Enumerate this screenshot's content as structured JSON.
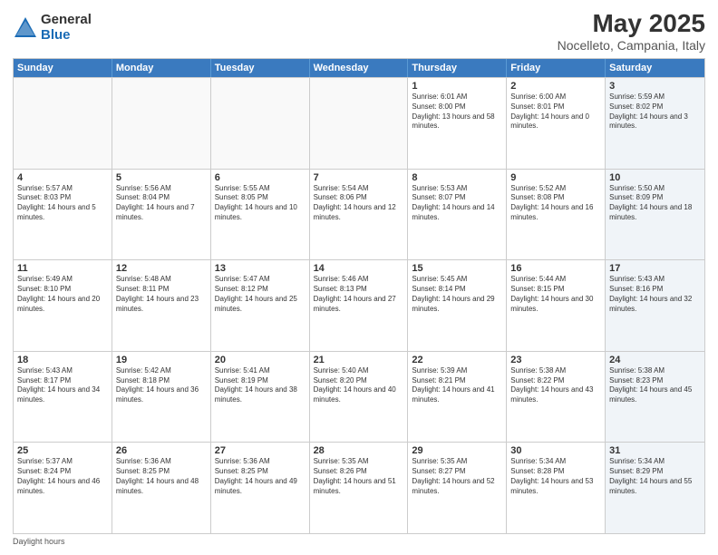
{
  "logo": {
    "general": "General",
    "blue": "Blue"
  },
  "title": "May 2025",
  "subtitle": "Nocelleto, Campania, Italy",
  "headers": [
    "Sunday",
    "Monday",
    "Tuesday",
    "Wednesday",
    "Thursday",
    "Friday",
    "Saturday"
  ],
  "rows": [
    [
      {
        "day": "",
        "empty": true
      },
      {
        "day": "",
        "empty": true
      },
      {
        "day": "",
        "empty": true
      },
      {
        "day": "",
        "empty": true
      },
      {
        "day": "1",
        "sunrise": "Sunrise: 6:01 AM",
        "sunset": "Sunset: 8:00 PM",
        "daylight": "Daylight: 13 hours and 58 minutes."
      },
      {
        "day": "2",
        "sunrise": "Sunrise: 6:00 AM",
        "sunset": "Sunset: 8:01 PM",
        "daylight": "Daylight: 14 hours and 0 minutes."
      },
      {
        "day": "3",
        "sunrise": "Sunrise: 5:59 AM",
        "sunset": "Sunset: 8:02 PM",
        "daylight": "Daylight: 14 hours and 3 minutes.",
        "shaded": true
      }
    ],
    [
      {
        "day": "4",
        "sunrise": "Sunrise: 5:57 AM",
        "sunset": "Sunset: 8:03 PM",
        "daylight": "Daylight: 14 hours and 5 minutes."
      },
      {
        "day": "5",
        "sunrise": "Sunrise: 5:56 AM",
        "sunset": "Sunset: 8:04 PM",
        "daylight": "Daylight: 14 hours and 7 minutes."
      },
      {
        "day": "6",
        "sunrise": "Sunrise: 5:55 AM",
        "sunset": "Sunset: 8:05 PM",
        "daylight": "Daylight: 14 hours and 10 minutes."
      },
      {
        "day": "7",
        "sunrise": "Sunrise: 5:54 AM",
        "sunset": "Sunset: 8:06 PM",
        "daylight": "Daylight: 14 hours and 12 minutes."
      },
      {
        "day": "8",
        "sunrise": "Sunrise: 5:53 AM",
        "sunset": "Sunset: 8:07 PM",
        "daylight": "Daylight: 14 hours and 14 minutes."
      },
      {
        "day": "9",
        "sunrise": "Sunrise: 5:52 AM",
        "sunset": "Sunset: 8:08 PM",
        "daylight": "Daylight: 14 hours and 16 minutes."
      },
      {
        "day": "10",
        "sunrise": "Sunrise: 5:50 AM",
        "sunset": "Sunset: 8:09 PM",
        "daylight": "Daylight: 14 hours and 18 minutes.",
        "shaded": true
      }
    ],
    [
      {
        "day": "11",
        "sunrise": "Sunrise: 5:49 AM",
        "sunset": "Sunset: 8:10 PM",
        "daylight": "Daylight: 14 hours and 20 minutes."
      },
      {
        "day": "12",
        "sunrise": "Sunrise: 5:48 AM",
        "sunset": "Sunset: 8:11 PM",
        "daylight": "Daylight: 14 hours and 23 minutes."
      },
      {
        "day": "13",
        "sunrise": "Sunrise: 5:47 AM",
        "sunset": "Sunset: 8:12 PM",
        "daylight": "Daylight: 14 hours and 25 minutes."
      },
      {
        "day": "14",
        "sunrise": "Sunrise: 5:46 AM",
        "sunset": "Sunset: 8:13 PM",
        "daylight": "Daylight: 14 hours and 27 minutes."
      },
      {
        "day": "15",
        "sunrise": "Sunrise: 5:45 AM",
        "sunset": "Sunset: 8:14 PM",
        "daylight": "Daylight: 14 hours and 29 minutes."
      },
      {
        "day": "16",
        "sunrise": "Sunrise: 5:44 AM",
        "sunset": "Sunset: 8:15 PM",
        "daylight": "Daylight: 14 hours and 30 minutes."
      },
      {
        "day": "17",
        "sunrise": "Sunrise: 5:43 AM",
        "sunset": "Sunset: 8:16 PM",
        "daylight": "Daylight: 14 hours and 32 minutes.",
        "shaded": true
      }
    ],
    [
      {
        "day": "18",
        "sunrise": "Sunrise: 5:43 AM",
        "sunset": "Sunset: 8:17 PM",
        "daylight": "Daylight: 14 hours and 34 minutes."
      },
      {
        "day": "19",
        "sunrise": "Sunrise: 5:42 AM",
        "sunset": "Sunset: 8:18 PM",
        "daylight": "Daylight: 14 hours and 36 minutes."
      },
      {
        "day": "20",
        "sunrise": "Sunrise: 5:41 AM",
        "sunset": "Sunset: 8:19 PM",
        "daylight": "Daylight: 14 hours and 38 minutes."
      },
      {
        "day": "21",
        "sunrise": "Sunrise: 5:40 AM",
        "sunset": "Sunset: 8:20 PM",
        "daylight": "Daylight: 14 hours and 40 minutes."
      },
      {
        "day": "22",
        "sunrise": "Sunrise: 5:39 AM",
        "sunset": "Sunset: 8:21 PM",
        "daylight": "Daylight: 14 hours and 41 minutes."
      },
      {
        "day": "23",
        "sunrise": "Sunrise: 5:38 AM",
        "sunset": "Sunset: 8:22 PM",
        "daylight": "Daylight: 14 hours and 43 minutes."
      },
      {
        "day": "24",
        "sunrise": "Sunrise: 5:38 AM",
        "sunset": "Sunset: 8:23 PM",
        "daylight": "Daylight: 14 hours and 45 minutes.",
        "shaded": true
      }
    ],
    [
      {
        "day": "25",
        "sunrise": "Sunrise: 5:37 AM",
        "sunset": "Sunset: 8:24 PM",
        "daylight": "Daylight: 14 hours and 46 minutes."
      },
      {
        "day": "26",
        "sunrise": "Sunrise: 5:36 AM",
        "sunset": "Sunset: 8:25 PM",
        "daylight": "Daylight: 14 hours and 48 minutes."
      },
      {
        "day": "27",
        "sunrise": "Sunrise: 5:36 AM",
        "sunset": "Sunset: 8:25 PM",
        "daylight": "Daylight: 14 hours and 49 minutes."
      },
      {
        "day": "28",
        "sunrise": "Sunrise: 5:35 AM",
        "sunset": "Sunset: 8:26 PM",
        "daylight": "Daylight: 14 hours and 51 minutes."
      },
      {
        "day": "29",
        "sunrise": "Sunrise: 5:35 AM",
        "sunset": "Sunset: 8:27 PM",
        "daylight": "Daylight: 14 hours and 52 minutes."
      },
      {
        "day": "30",
        "sunrise": "Sunrise: 5:34 AM",
        "sunset": "Sunset: 8:28 PM",
        "daylight": "Daylight: 14 hours and 53 minutes."
      },
      {
        "day": "31",
        "sunrise": "Sunrise: 5:34 AM",
        "sunset": "Sunset: 8:29 PM",
        "daylight": "Daylight: 14 hours and 55 minutes.",
        "shaded": true
      }
    ]
  ],
  "footer": "Daylight hours"
}
